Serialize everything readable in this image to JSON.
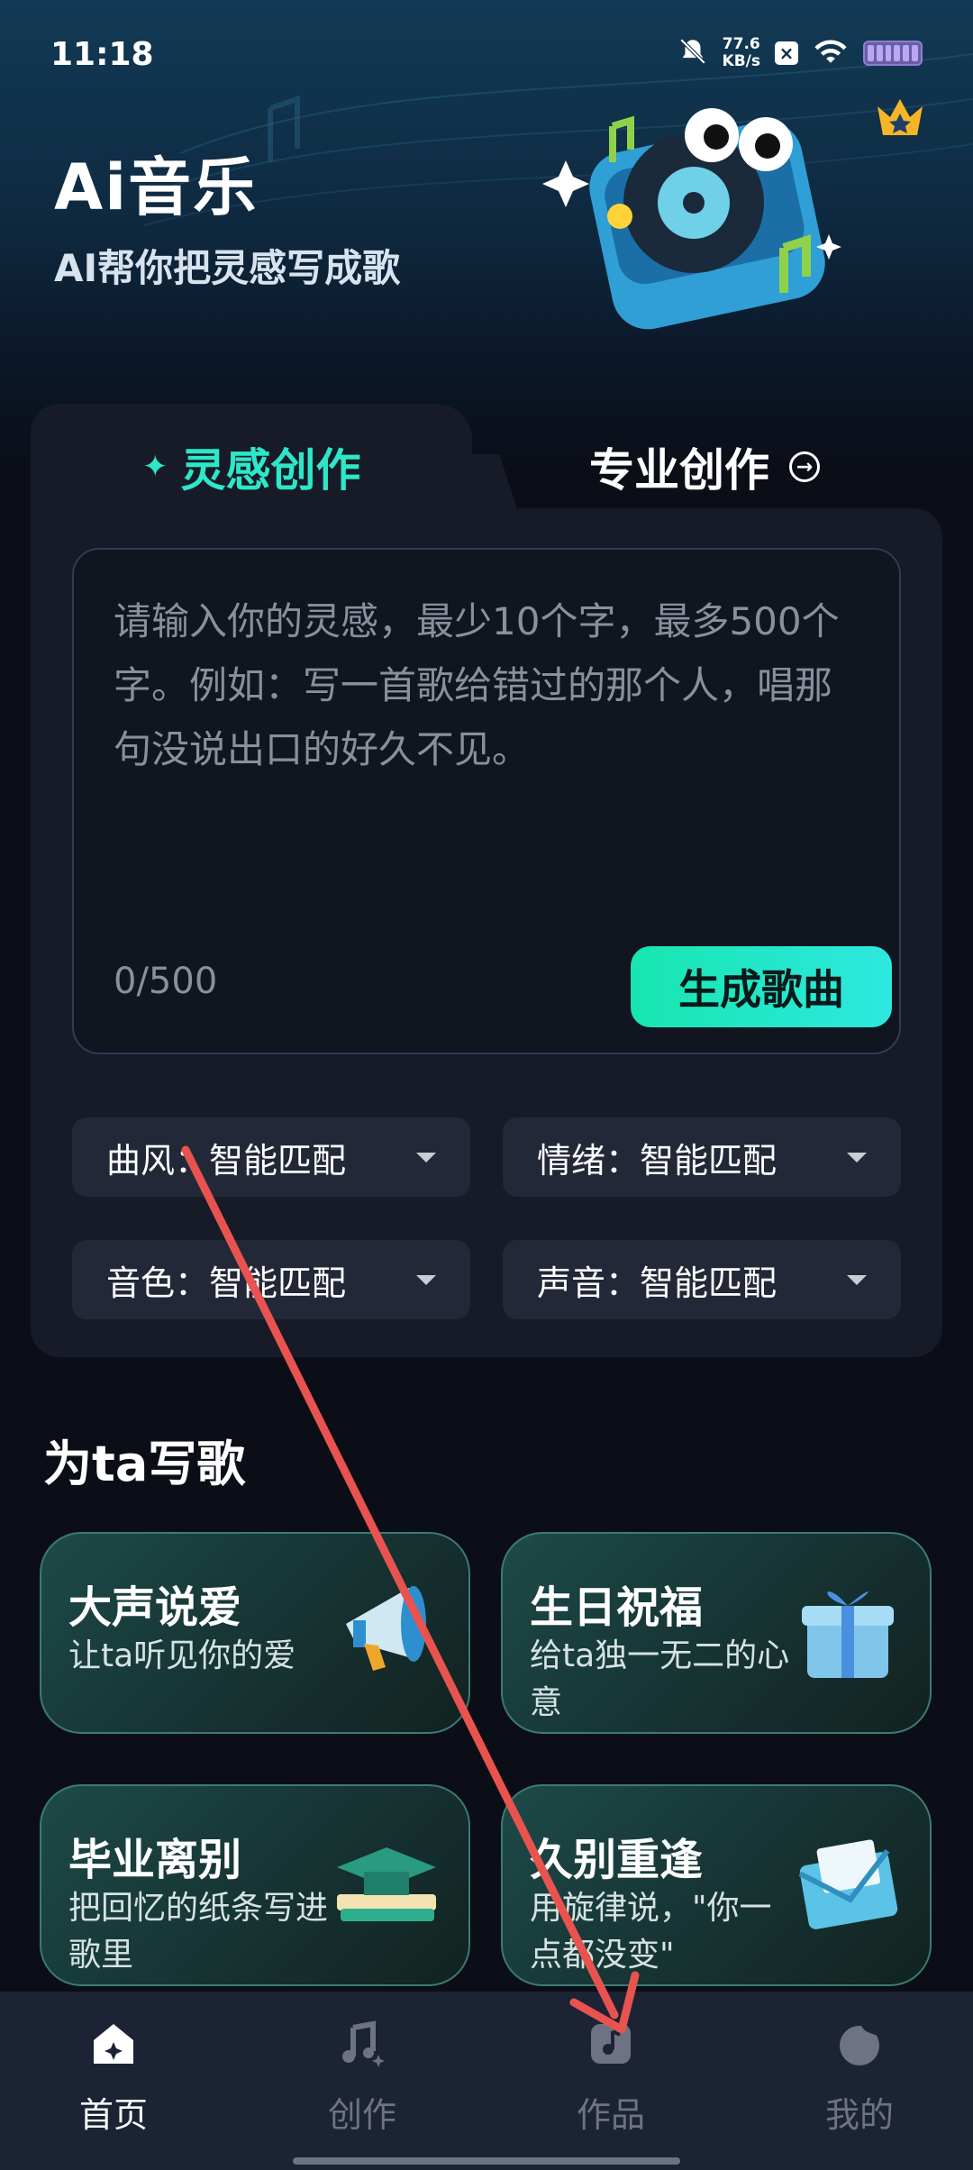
{
  "status": {
    "time": "11:18",
    "speed_value": "77.6",
    "speed_unit": "KB/s"
  },
  "header": {
    "title": "Ai音乐",
    "subtitle": "AI帮你把灵感写成歌"
  },
  "tabs": {
    "inspire": "灵感创作",
    "pro": "专业创作"
  },
  "input": {
    "placeholder": "请输入你的灵感，最少10个字，最多500个字。例如：写一首歌给错过的那个人，唱那句没说出口的好久不见。",
    "count": "0/500"
  },
  "generate_button": "生成歌曲",
  "options": [
    {
      "label": "曲风：智能匹配"
    },
    {
      "label": "情绪：智能匹配"
    },
    {
      "label": "音色：智能匹配"
    },
    {
      "label": "声音：智能匹配"
    }
  ],
  "section": {
    "title": "为ta写歌",
    "cards": [
      {
        "title": "大声说爱",
        "desc": "让ta听见你的爱",
        "icon": "megaphone-icon"
      },
      {
        "title": "生日祝福",
        "desc": "给ta独一无二的心意",
        "icon": "gift-icon"
      },
      {
        "title": "毕业离别",
        "desc": "把回忆的纸条写进歌里",
        "icon": "graduation-cap-icon"
      },
      {
        "title": "久别重逢",
        "desc": "用旋律说，\"你一点都没变\"",
        "icon": "envelope-icon"
      }
    ]
  },
  "nav": [
    {
      "label": "首页",
      "icon": "home-icon",
      "active": true
    },
    {
      "label": "创作",
      "icon": "music-note-icon",
      "active": false
    },
    {
      "label": "作品",
      "icon": "music-file-icon",
      "active": false
    },
    {
      "label": "我的",
      "icon": "profile-icon",
      "active": false
    }
  ],
  "colors": {
    "accent": "#2ee6c8",
    "background": "#0b0e17",
    "card": "#161b27",
    "annotation_arrow": "#e8534f"
  }
}
